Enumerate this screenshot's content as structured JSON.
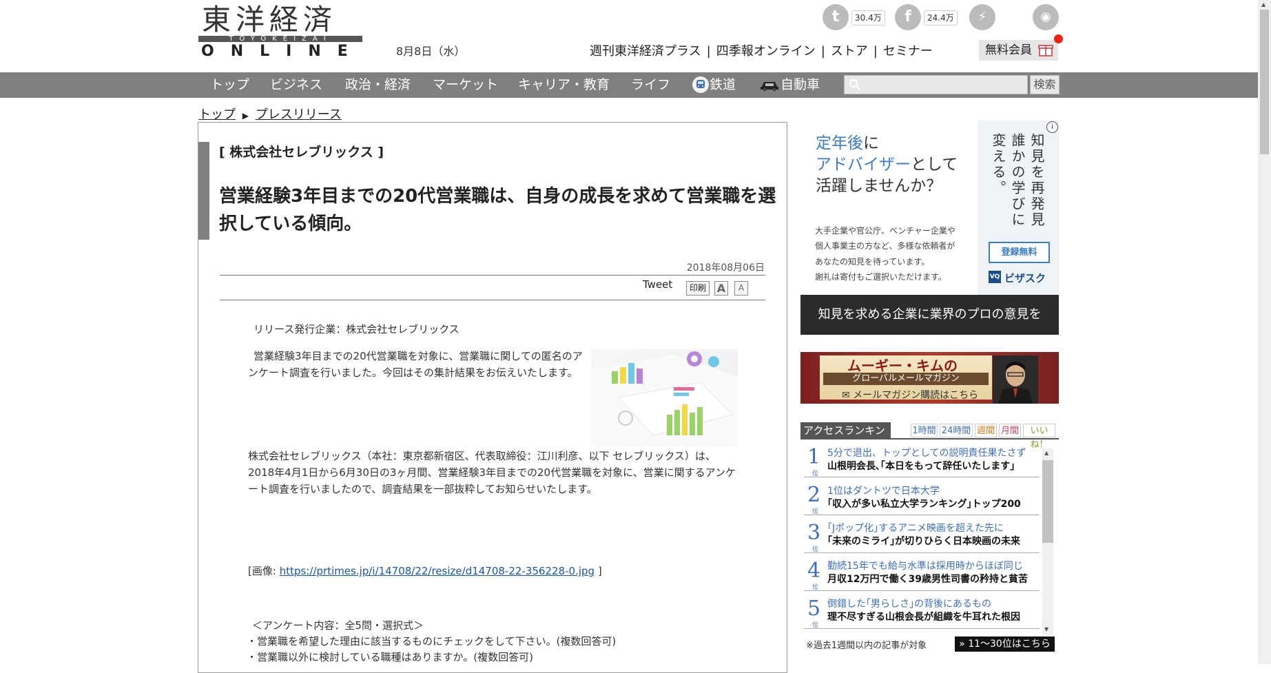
{
  "header": {
    "logo_main": "東洋経済",
    "logo_sub": "TOYOKEIZAI",
    "logo_online": "ONLINE",
    "date": "8月8日（水）",
    "social": [
      {
        "icon": "twitter-icon",
        "glyph": "t",
        "count": "30.4万"
      },
      {
        "icon": "facebook-icon",
        "glyph": "f",
        "count": "24.4万"
      },
      {
        "icon": "messenger-icon",
        "glyph": "⚡"
      },
      {
        "icon": "rss-icon",
        "glyph": "◉"
      }
    ],
    "top_links": [
      "週刊東洋経済プラス",
      "四季報オンライン",
      "ストア",
      "セミナー"
    ],
    "top_links_sep": "|",
    "free_member": "無料会員"
  },
  "nav": {
    "items": [
      "トップ",
      "ビジネス",
      "政治・経済",
      "マーケット",
      "キャリア・教育",
      "ライフ",
      "鉄道",
      "自動車"
    ],
    "search_placeholder": "",
    "search_button": "検索",
    "colors": {
      "bar": "#808080"
    }
  },
  "breadcrumb": {
    "home": "トップ",
    "current": "プレスリリース"
  },
  "article": {
    "company_tag": "[ 株式会社セレブリックス ]",
    "headline": "営業経験3年目までの20代営業職は、自身の成長を求めて営業職を選択している傾向。",
    "pub_date": "2018年08月06日",
    "tweet": "Tweet",
    "print": "印刷",
    "font_large": "A",
    "font_small": "A",
    "issuer": "リリース発行企業：株式会社セレブリックス",
    "para1": "営業経験3年目までの20代営業職を対象に、営業職に関しての匿名のアンケート調査を行いました。今回はその集計結果をお伝えいたします。",
    "para2": "株式会社セレブリックス（本社：東京都新宿区、代表取締役：江川利彦、以下 セレブリックス）は、2018年4月1日から6月30日の3ヶ月間、営業経験3年目までの20代営業職を対象に、営業に関するアンケート調査を行いましたので、調査結果を一部抜粋してお知らせいたします。",
    "image_prefix": "[画像: ",
    "image_url": "https://prtimes.jp/i/14708/22/resize/d14708-22-356228-0.jpg",
    "image_suffix": " ]",
    "survey_title": "＜アンケート内容：全5問・選択式＞",
    "survey_items": [
      "・営業職を希望した理由に該当するものにチェックをして下さい。(複数回答可)",
      "・営業職以外に検討している職種はありますか。(複数回答可)"
    ]
  },
  "ad1": {
    "title_l1_a": "定年後",
    "title_l1_b": "に",
    "title_l2_a": "アドバイザー",
    "title_l2_b": "として",
    "title_l3": "活躍しませんか？",
    "body": [
      "大手企業や官公庁、ベンチャー企業や",
      "個人事業主の方など、多様な依頼者が",
      "あなたの知見を待っています。",
      "謝礼は寄付もご選択いただけます。"
    ],
    "vertical_1": "知見を再発見",
    "vertical_2": "誰かの学びに",
    "vertical_3": "変える。",
    "register": "登録無料",
    "brand": "ビザスク",
    "brand_mark": "VQ",
    "info": "i",
    "bottom": "知見を求める企業に業界のプロの意見を"
  },
  "ad2": {
    "title": "ムーギー・キムの",
    "sub": "グローバルメールマガジン",
    "cta": "✉ メールマガジン購読はこちら"
  },
  "ranking": {
    "title": "アクセスランキング",
    "tabs": [
      "1時間",
      "24時間",
      "週間",
      "月間",
      "いいね！"
    ],
    "rank_suffix": "位",
    "items": [
      {
        "rank": "1",
        "kicker": "5分で退出、トップとしての説明責任果たさず",
        "title": "山根明会長､｢本日をもって辞任いたします｣"
      },
      {
        "rank": "2",
        "kicker": "1位はダントツで日本大学",
        "title": "｢収入が多い私立大学ランキング｣トップ200"
      },
      {
        "rank": "3",
        "kicker": "｢Jポップ化｣するアニメ映画を超えた先に",
        "title": "｢未来のミライ｣が切りひらく日本映画の未来"
      },
      {
        "rank": "4",
        "kicker": "勤続15年でも給与水準は採用時からほぼ同じ",
        "title": "月収12万円で働く39歳男性司書の矜持と貧苦"
      },
      {
        "rank": "5",
        "kicker": "倒錯した｢男らしさ｣の背後にあるもの",
        "title": "理不尽すぎる山根会長が組織を牛耳れた根因"
      }
    ],
    "note": "※過去1週間以内の記事が対象",
    "more": "» 11〜30位はこちら"
  }
}
